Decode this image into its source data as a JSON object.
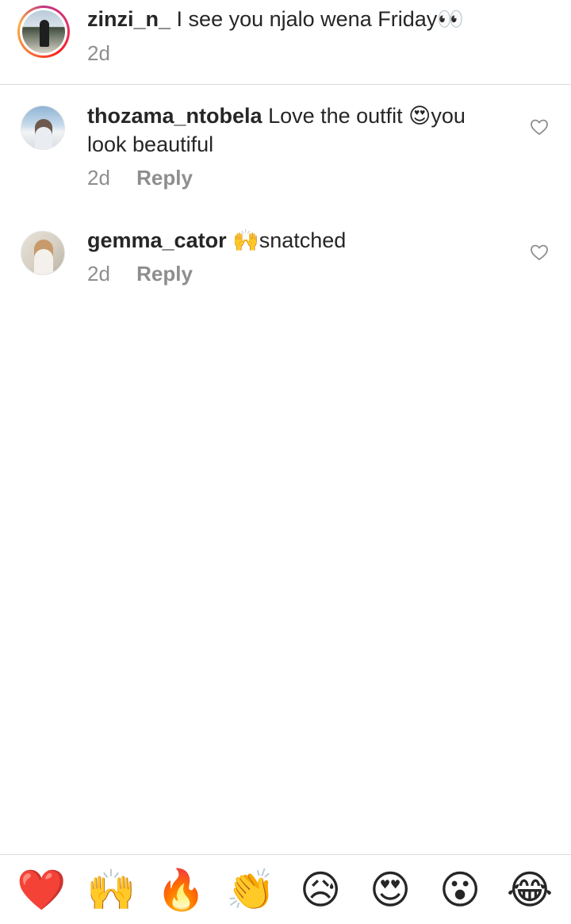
{
  "caption": {
    "username": "zinzi_n_",
    "text": "I see you njalo wena Friday👀",
    "time": "2d"
  },
  "comments": [
    {
      "username": "thozama_ntobela",
      "text": "Love the outfit 😍you look beautiful",
      "time": "2d",
      "reply_label": "Reply",
      "like_icon": "heart-outline-icon"
    },
    {
      "username": "gemma_cator",
      "text": "🙌snatched",
      "time": "2d",
      "reply_label": "Reply",
      "like_icon": "heart-outline-icon"
    }
  ],
  "emoji_bar": [
    "❤️",
    "🙌",
    "🔥",
    "👏",
    "😥",
    "😍",
    "😮",
    "😂"
  ],
  "colors": {
    "text": "#262626",
    "muted": "#8e8e8e",
    "divider": "#dbdbdb"
  }
}
